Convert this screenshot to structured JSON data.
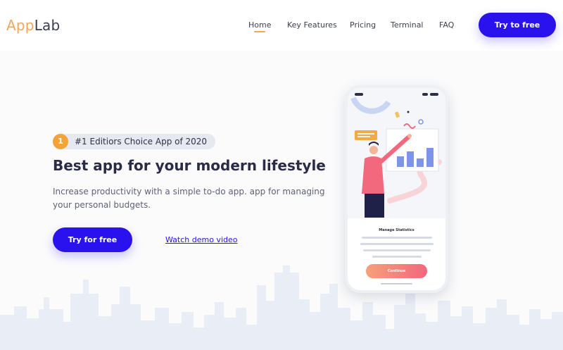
{
  "brand": {
    "part1": "App",
    "part2": "Lab"
  },
  "nav": {
    "items": [
      {
        "label": "Home",
        "active": true
      },
      {
        "label": "Key Features",
        "active": false
      },
      {
        "label": "Pricing",
        "active": false
      },
      {
        "label": "Terminal",
        "active": false
      },
      {
        "label": "FAQ",
        "active": false
      }
    ],
    "cta_label": "Try to free"
  },
  "hero": {
    "badge_icon": "1",
    "badge_text": "#1 Editiors Choice App of 2020",
    "headline": "Best app for your modern lifestyle",
    "description": "Increase productivity with a simple to-do app. app for managing your personal budgets.",
    "cta_label": "Try for free",
    "demo_label": "Watch demo video"
  },
  "phone": {
    "card_title": "Manage Statistics",
    "button_label": "Continue",
    "icons": [
      "medal-icon",
      "rocket-icon",
      "chart-icon",
      "person-illustration"
    ]
  },
  "colors": {
    "accent": "#2a12ee",
    "brand_orange": "#f3a65b",
    "heading": "#2a2c45",
    "skyline": "#e9eef6"
  }
}
